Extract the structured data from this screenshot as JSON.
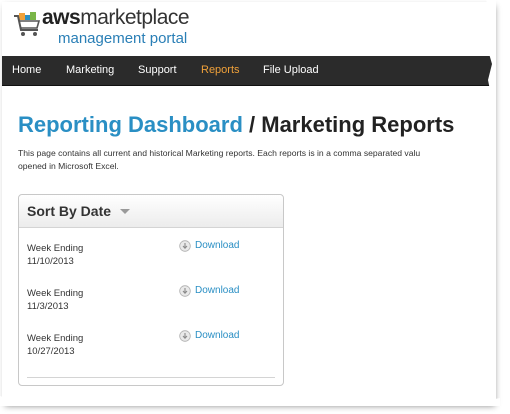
{
  "logo": {
    "brand_bold": "aws",
    "brand_rest": "marketplace",
    "subtitle": "management portal"
  },
  "nav": {
    "items": [
      {
        "label": "Home"
      },
      {
        "label": "Marketing"
      },
      {
        "label": "Support"
      },
      {
        "label": "Reports"
      },
      {
        "label": "File Upload"
      }
    ],
    "active": "Reports",
    "active_color": "#f0a13a"
  },
  "title": {
    "breadcrumb_link": "Reporting Dashboard",
    "separator": " / ",
    "current": "Marketing Reports"
  },
  "description": {
    "line1": "This page contains all current and historical Marketing reports. Each reports is in a comma separated valu",
    "line2": "opened in Microsoft Excel."
  },
  "sort_panel": {
    "title": "Sort By Date",
    "reports": [
      {
        "label": "Week Ending",
        "date": "11/10/2013",
        "action": "Download"
      },
      {
        "label": "Week Ending",
        "date": "11/3/2013",
        "action": "Download"
      },
      {
        "label": "Week Ending",
        "date": "10/27/2013",
        "action": "Download"
      }
    ]
  },
  "colors": {
    "link": "#2a8fc4",
    "nav_bg": "#2b2b2b"
  }
}
